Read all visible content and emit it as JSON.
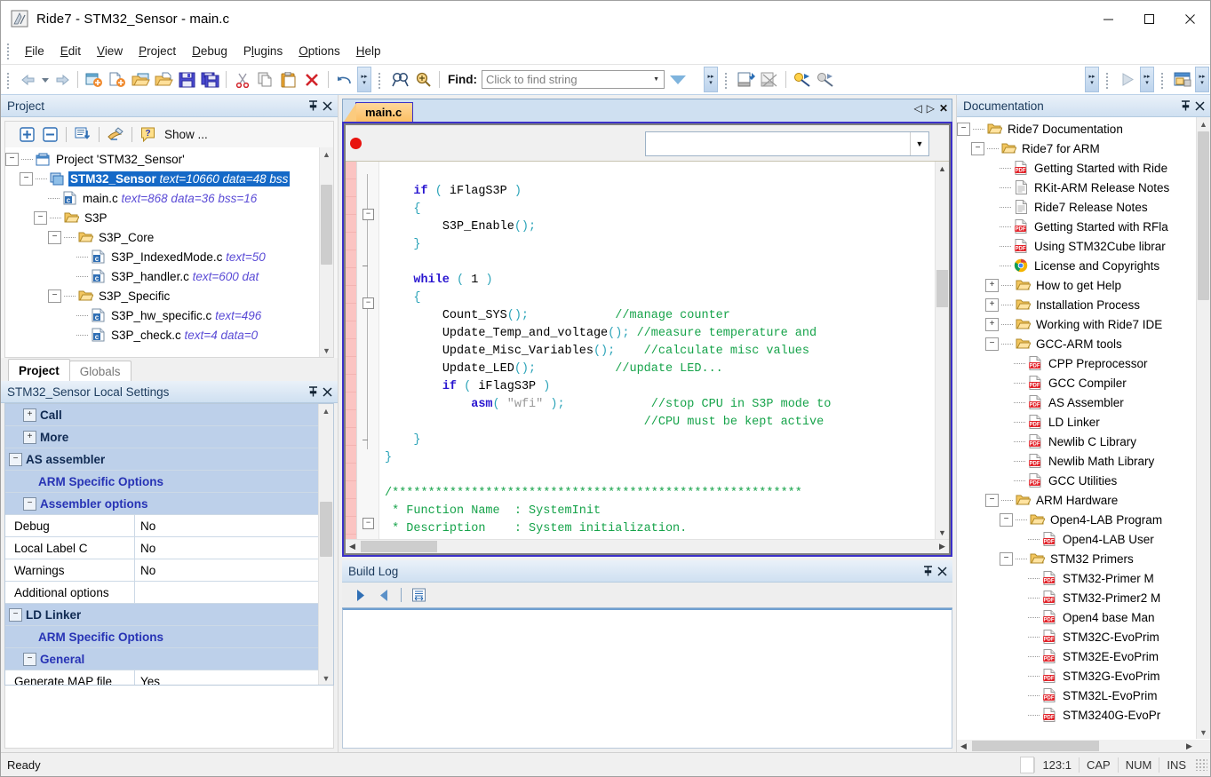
{
  "window": {
    "title": "Ride7 - STM32_Sensor - main.c",
    "app_icon": "ride7-icon",
    "minimize_label": "—",
    "maximize_label": "☐",
    "close_label": "✕"
  },
  "menubar": {
    "items": [
      {
        "label": "File",
        "accel": "F"
      },
      {
        "label": "Edit",
        "accel": "E"
      },
      {
        "label": "View",
        "accel": "V"
      },
      {
        "label": "Project",
        "accel": "P"
      },
      {
        "label": "Debug",
        "accel": "D"
      },
      {
        "label": "Plugins",
        "accel": "l"
      },
      {
        "label": "Options",
        "accel": "O"
      },
      {
        "label": "Help",
        "accel": "H"
      }
    ]
  },
  "toolbar": {
    "back_icon": "back-arrow-icon",
    "forward_icon": "forward-arrow-icon",
    "new_project_icon": "new-project-icon",
    "new_file_icon": "new-file-icon",
    "open_project_icon": "open-project-icon",
    "open_file_icon": "open-file-icon",
    "save_icon": "save-icon",
    "save_all_icon": "save-all-icon",
    "cut_icon": "cut-icon",
    "copy_icon": "copy-icon",
    "paste_icon": "paste-icon",
    "delete_icon": "delete-icon",
    "undo_icon": "undo-icon",
    "find_icon": "find-icon",
    "find_replace_icon": "find-replace-icon",
    "find_label": "Find:",
    "find_placeholder": "Click to find string",
    "find_value": "",
    "find_dropdown_icon": "chevron-down-icon",
    "find_go_icon": "filter-triangle-icon",
    "build_icon": "build-icon",
    "rebuild_icon": "rebuild-icon",
    "debug_start_icon": "debug-start-icon",
    "debug_stop_icon": "debug-stop-icon",
    "run_icon": "run-triangle-icon",
    "window_icon": "window-icon",
    "overflow_icon": "toolbar-overflow-icon"
  },
  "project_panel": {
    "caption": "Project",
    "pin_icon": "pin-icon",
    "close_icon": "close-icon",
    "toolbar": {
      "expand_all_icon": "expand-all-icon",
      "collapse_all_icon": "collapse-all-icon",
      "sort_icon": "sort-icon",
      "properties_icon": "properties-icon",
      "help_icon": "help-icon",
      "show_label": "Show ..."
    },
    "tree": [
      {
        "depth": 0,
        "toggle": "-",
        "icon": "project-icon",
        "name": "Project 'STM32_Sensor'",
        "meta": "",
        "selected": false
      },
      {
        "depth": 1,
        "toggle": "-",
        "icon": "app-icon",
        "name": "STM32_Sensor",
        "meta": "text=10660 data=48 bss",
        "selected": true
      },
      {
        "depth": 2,
        "toggle": "",
        "icon": "c-file-icon",
        "name": "main.c",
        "meta": "text=868 data=36 bss=16",
        "selected": false
      },
      {
        "depth": 2,
        "toggle": "-",
        "icon": "folder-icon",
        "name": "S3P",
        "meta": "",
        "selected": false
      },
      {
        "depth": 3,
        "toggle": "-",
        "icon": "folder-icon",
        "name": "S3P_Core",
        "meta": "",
        "selected": false
      },
      {
        "depth": 4,
        "toggle": "",
        "icon": "c-file-icon",
        "name": "S3P_IndexedMode.c",
        "meta": "text=50",
        "selected": false
      },
      {
        "depth": 4,
        "toggle": "",
        "icon": "c-file-icon",
        "name": "S3P_handler.c",
        "meta": "text=600 dat",
        "selected": false
      },
      {
        "depth": 3,
        "toggle": "-",
        "icon": "folder-icon",
        "name": "S3P_Specific",
        "meta": "",
        "selected": false
      },
      {
        "depth": 4,
        "toggle": "",
        "icon": "c-file-icon",
        "name": "S3P_hw_specific.c",
        "meta": "text=496",
        "selected": false
      },
      {
        "depth": 4,
        "toggle": "",
        "icon": "c-file-icon",
        "name": "S3P_check.c",
        "meta": "text=4 data=0",
        "selected": false
      }
    ],
    "tabs": [
      {
        "label": "Project",
        "active": true
      },
      {
        "label": "Globals",
        "active": false
      }
    ]
  },
  "settings_panel": {
    "caption": "STM32_Sensor Local Settings",
    "pin_icon": "pin-icon",
    "close_icon": "close-icon",
    "rows": [
      {
        "kind": "cat",
        "toggle": "+",
        "indent": 1,
        "name": "Call",
        "value": ""
      },
      {
        "kind": "cat",
        "toggle": "+",
        "indent": 1,
        "name": "More",
        "value": ""
      },
      {
        "kind": "cat",
        "toggle": "-",
        "indent": 0,
        "name": "AS assembler",
        "value": ""
      },
      {
        "kind": "cat2",
        "toggle": "",
        "indent": 1,
        "name": "ARM Specific Options",
        "value": ""
      },
      {
        "kind": "cat2",
        "toggle": "-",
        "indent": 1,
        "name": "Assembler options",
        "value": ""
      },
      {
        "kind": "leaf",
        "toggle": "",
        "indent": 2,
        "name": "Debug",
        "value": "No"
      },
      {
        "kind": "leaf",
        "toggle": "",
        "indent": 2,
        "name": "Local Label C",
        "value": "No"
      },
      {
        "kind": "leaf",
        "toggle": "",
        "indent": 2,
        "name": "Warnings",
        "value": "No"
      },
      {
        "kind": "leaf",
        "toggle": "",
        "indent": 2,
        "name": "Additional options",
        "value": ""
      },
      {
        "kind": "cat",
        "toggle": "-",
        "indent": 0,
        "name": "LD Linker",
        "value": ""
      },
      {
        "kind": "cat2",
        "toggle": "",
        "indent": 1,
        "name": "ARM Specific Options",
        "value": ""
      },
      {
        "kind": "cat2",
        "toggle": "-",
        "indent": 1,
        "name": "General",
        "value": ""
      },
      {
        "kind": "leaf",
        "toggle": "",
        "indent": 2,
        "name": "Generate MAP file",
        "value": "Yes"
      }
    ]
  },
  "editor": {
    "tab_label": "main.c",
    "nav_prev_icon": "nav-prev-icon",
    "nav_next_icon": "nav-next-icon",
    "close_icon": "close-icon",
    "breakpoint_icon": "breakpoint-dot-icon",
    "combo_value": "",
    "combo_dropdown_icon": "chevron-down-icon",
    "lines": [
      [],
      [
        {
          "t": "sp",
          "v": "    "
        },
        {
          "t": "kw",
          "v": "if"
        },
        {
          "t": "id",
          "v": " "
        },
        {
          "t": "pn",
          "v": "("
        },
        {
          "t": "id",
          "v": " iFlagS3P "
        },
        {
          "t": "pn",
          "v": ")"
        }
      ],
      [
        {
          "t": "sp",
          "v": "    "
        },
        {
          "t": "pn",
          "v": "{"
        }
      ],
      [
        {
          "t": "sp",
          "v": "        "
        },
        {
          "t": "id",
          "v": "S3P_Enable"
        },
        {
          "t": "pn",
          "v": "();"
        }
      ],
      [
        {
          "t": "sp",
          "v": "    "
        },
        {
          "t": "pn",
          "v": "}"
        }
      ],
      [],
      [
        {
          "t": "sp",
          "v": "    "
        },
        {
          "t": "kw",
          "v": "while"
        },
        {
          "t": "id",
          "v": " "
        },
        {
          "t": "pn",
          "v": "("
        },
        {
          "t": "id",
          "v": " 1 "
        },
        {
          "t": "pn",
          "v": ")"
        }
      ],
      [
        {
          "t": "sp",
          "v": "    "
        },
        {
          "t": "pn",
          "v": "{"
        }
      ],
      [
        {
          "t": "sp",
          "v": "        "
        },
        {
          "t": "id",
          "v": "Count_SYS"
        },
        {
          "t": "pn",
          "v": "();"
        },
        {
          "t": "sp",
          "v": "            "
        },
        {
          "t": "cm",
          "v": "//manage counter"
        }
      ],
      [
        {
          "t": "sp",
          "v": "        "
        },
        {
          "t": "id",
          "v": "Update_Temp_and_voltage"
        },
        {
          "t": "pn",
          "v": "();"
        },
        {
          "t": "sp",
          "v": " "
        },
        {
          "t": "cm",
          "v": "//measure temperature and"
        }
      ],
      [
        {
          "t": "sp",
          "v": "        "
        },
        {
          "t": "id",
          "v": "Update_Misc_Variables"
        },
        {
          "t": "pn",
          "v": "();"
        },
        {
          "t": "sp",
          "v": "    "
        },
        {
          "t": "cm",
          "v": "//calculate misc values"
        }
      ],
      [
        {
          "t": "sp",
          "v": "        "
        },
        {
          "t": "id",
          "v": "Update_LED"
        },
        {
          "t": "pn",
          "v": "();"
        },
        {
          "t": "sp",
          "v": "           "
        },
        {
          "t": "cm",
          "v": "//update LED..."
        }
      ],
      [
        {
          "t": "sp",
          "v": "        "
        },
        {
          "t": "kw",
          "v": "if"
        },
        {
          "t": "id",
          "v": " "
        },
        {
          "t": "pn",
          "v": "("
        },
        {
          "t": "id",
          "v": " iFlagS3P "
        },
        {
          "t": "pn",
          "v": ")"
        }
      ],
      [
        {
          "t": "sp",
          "v": "            "
        },
        {
          "t": "kw",
          "v": "asm"
        },
        {
          "t": "pn",
          "v": "("
        },
        {
          "t": "st",
          "v": " \"wfi\" "
        },
        {
          "t": "pn",
          "v": ");"
        },
        {
          "t": "sp",
          "v": "            "
        },
        {
          "t": "cm",
          "v": "//stop CPU in S3P mode to"
        }
      ],
      [
        {
          "t": "sp",
          "v": "                                    "
        },
        {
          "t": "cm",
          "v": "//CPU must be kept active"
        }
      ],
      [
        {
          "t": "sp",
          "v": "    "
        },
        {
          "t": "pn",
          "v": "}"
        }
      ],
      [
        {
          "t": "pn",
          "v": "}"
        }
      ],
      [],
      [
        {
          "t": "cm",
          "v": "/*********************************************************"
        }
      ],
      [
        {
          "t": "cm",
          "v": " * Function Name  : SystemInit"
        }
      ],
      [
        {
          "t": "cm",
          "v": " * Description    : System initialization."
        }
      ]
    ],
    "hscroll_left_icon": "scroll-left-icon",
    "hscroll_right_icon": "scroll-right-icon"
  },
  "build_log": {
    "caption": "Build Log",
    "pin_icon": "pin-icon",
    "close_icon": "close-icon",
    "next_icon": "next-error-icon",
    "prev_icon": "prev-error-icon",
    "wrap_icon": "word-wrap-icon",
    "content": ""
  },
  "documentation_panel": {
    "caption": "Documentation",
    "pin_icon": "pin-icon",
    "close_icon": "close-icon",
    "tree": [
      {
        "depth": 0,
        "toggle": "-",
        "icon": "folder-icon",
        "name": "Ride7 Documentation"
      },
      {
        "depth": 1,
        "toggle": "-",
        "icon": "folder-icon",
        "name": "Ride7 for ARM"
      },
      {
        "depth": 2,
        "toggle": "",
        "icon": "pdf-icon",
        "name": "Getting Started with Ride"
      },
      {
        "depth": 2,
        "toggle": "",
        "icon": "doc-icon",
        "name": "RKit-ARM Release Notes"
      },
      {
        "depth": 2,
        "toggle": "",
        "icon": "doc-icon",
        "name": "Ride7 Release Notes"
      },
      {
        "depth": 2,
        "toggle": "",
        "icon": "pdf-icon",
        "name": "Getting Started with RFla"
      },
      {
        "depth": 2,
        "toggle": "",
        "icon": "pdf-icon",
        "name": "Using STM32Cube librar"
      },
      {
        "depth": 2,
        "toggle": "",
        "icon": "chrome-icon",
        "name": "License and Copyrights"
      },
      {
        "depth": 2,
        "toggle": "+",
        "icon": "folder-icon",
        "name": "How to get Help"
      },
      {
        "depth": 2,
        "toggle": "+",
        "icon": "folder-icon",
        "name": "Installation Process"
      },
      {
        "depth": 2,
        "toggle": "+",
        "icon": "folder-icon",
        "name": "Working with Ride7 IDE"
      },
      {
        "depth": 2,
        "toggle": "-",
        "icon": "folder-icon",
        "name": "GCC-ARM tools"
      },
      {
        "depth": 3,
        "toggle": "",
        "icon": "pdf-icon",
        "name": "CPP Preprocessor"
      },
      {
        "depth": 3,
        "toggle": "",
        "icon": "pdf-icon",
        "name": "GCC Compiler"
      },
      {
        "depth": 3,
        "toggle": "",
        "icon": "pdf-icon",
        "name": "AS Assembler"
      },
      {
        "depth": 3,
        "toggle": "",
        "icon": "pdf-icon",
        "name": "LD Linker"
      },
      {
        "depth": 3,
        "toggle": "",
        "icon": "pdf-icon",
        "name": "Newlib C Library"
      },
      {
        "depth": 3,
        "toggle": "",
        "icon": "pdf-icon",
        "name": "Newlib Math Library"
      },
      {
        "depth": 3,
        "toggle": "",
        "icon": "pdf-icon",
        "name": "GCC Utilities"
      },
      {
        "depth": 2,
        "toggle": "-",
        "icon": "folder-icon",
        "name": "ARM Hardware"
      },
      {
        "depth": 3,
        "toggle": "-",
        "icon": "folder-icon",
        "name": "Open4-LAB Program"
      },
      {
        "depth": 4,
        "toggle": "",
        "icon": "pdf-icon",
        "name": "Open4-LAB User"
      },
      {
        "depth": 3,
        "toggle": "-",
        "icon": "folder-icon",
        "name": "STM32 Primers"
      },
      {
        "depth": 4,
        "toggle": "",
        "icon": "pdf-icon",
        "name": "STM32-Primer M"
      },
      {
        "depth": 4,
        "toggle": "",
        "icon": "pdf-icon",
        "name": "STM32-Primer2 M"
      },
      {
        "depth": 4,
        "toggle": "",
        "icon": "pdf-icon",
        "name": "Open4 base Man"
      },
      {
        "depth": 4,
        "toggle": "",
        "icon": "pdf-icon",
        "name": "STM32C-EvoPrim"
      },
      {
        "depth": 4,
        "toggle": "",
        "icon": "pdf-icon",
        "name": "STM32E-EvoPrim"
      },
      {
        "depth": 4,
        "toggle": "",
        "icon": "pdf-icon",
        "name": "STM32G-EvoPrim"
      },
      {
        "depth": 4,
        "toggle": "",
        "icon": "pdf-icon",
        "name": "STM32L-EvoPrim"
      },
      {
        "depth": 4,
        "toggle": "",
        "icon": "pdf-icon",
        "name": "STM3240G-EvoPr"
      }
    ]
  },
  "statusbar": {
    "message": "Ready",
    "cursor": "123:1",
    "caps": "CAP",
    "num": "NUM",
    "ins": "INS"
  },
  "colors": {
    "accent_blue": "#1569c7",
    "tab_orange": "#fbbf63",
    "editor_border": "#3b30c9",
    "breakpoint_red": "#e8130e",
    "comment_green": "#16a34a",
    "keyword_blue": "#2916d0",
    "modified_strip": "#fbc4c2"
  }
}
